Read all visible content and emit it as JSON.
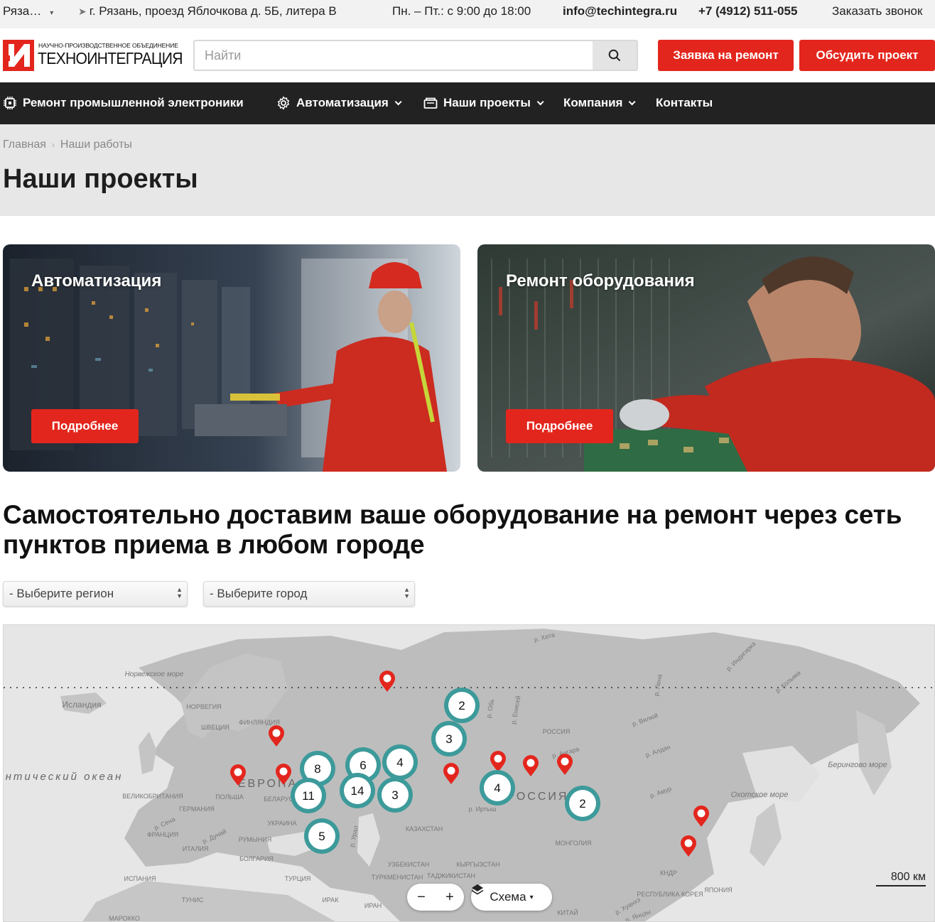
{
  "topbar": {
    "city": "Ряза…",
    "address": "г. Рязань, проезд Яблочкова д. 5Б, литера В",
    "hours": "Пн. – Пт.: с 9:00 до 18:00",
    "email": "info@techintegra.ru",
    "phone": "+7 (4912) 511-055",
    "callback": "Заказать звонок"
  },
  "logo": {
    "small": "НАУЧНО-ПРОИЗВОДСТВЕННОЕ ОБЪЕДИНЕНИЕ",
    "big": "ТЕХНОИНТЕГРАЦИЯ"
  },
  "search": {
    "placeholder": "Найти"
  },
  "header": {
    "repair_btn": "Заявка на ремонт",
    "discuss_btn": "Обсудить проект"
  },
  "nav": {
    "items": [
      {
        "label": "Ремонт промышленной электроники"
      },
      {
        "label": "Автоматизация"
      },
      {
        "label": "Наши проекты"
      },
      {
        "label": "Компания"
      },
      {
        "label": "Контакты"
      }
    ]
  },
  "breadcrumb": {
    "home": "Главная",
    "current": "Наши работы"
  },
  "page_title": "Наши проекты",
  "cards": [
    {
      "title": "Автоматизация",
      "button": "Подробнее"
    },
    {
      "title": "Ремонт оборудования",
      "button": "Подробнее"
    }
  ],
  "delivery_heading": "Самостоятельно доставим ваше оборудование на ремонт через сеть пунктов приема в любом городе",
  "filters": {
    "region": "- Выберите регион",
    "city": "- Выберите город"
  },
  "map": {
    "clusters": [
      "2",
      "3",
      "8",
      "6",
      "4",
      "11",
      "14",
      "3",
      "5",
      "4",
      "2"
    ],
    "labels": {
      "norway_sea": "Норвежское море",
      "iceland": "Исландия",
      "norway": "НОРВЕГИЯ",
      "finland": "ФИНЛЯНДИЯ",
      "sweden": "ШВЕЦИЯ",
      "atlantic": "Атлантический океан",
      "uk": "ВЕЛИКОБРИТАНИЯ",
      "poland": "ПОЛЬША",
      "belarus": "БЕЛАРУСЬ",
      "germany": "ГЕРМАНИЯ",
      "europe": "ЕВРОПА",
      "ukraine": "УКРАИНА",
      "france": "ФРАНЦИЯ",
      "romania": "РУМЫНИЯ",
      "italy": "ИТАЛИЯ",
      "bulgaria": "БОЛГАРИЯ",
      "spain": "ИСПАНИЯ",
      "turkey": "ТУРЦИЯ",
      "tunisia": "ТУНИС",
      "iraq": "ИРАК",
      "iran": "ИРАН",
      "morocco": "МАРОККО",
      "kazakhstan": "КАЗАХСТАН",
      "uzbekistan": "УЗБЕКИСТАН",
      "turkmenistan": "ТУРКМЕНИСТАН",
      "kyrgyzstan": "КЫРГЫЗСТАН",
      "tajikistan": "ТАДЖИКИСТАН",
      "mongolia": "МОНГОЛИЯ",
      "china": "КИТАЙ",
      "russia_small": "РОССИЯ",
      "russia_big": "РОССИЯ",
      "bering_sea": "Берингово море",
      "okhotsk_sea": "Охотское море",
      "korea": "РЕСПУБЛИКА КОРЕЯ",
      "japan": "ЯПОНИЯ",
      "kndr": "КНДР",
      "ural": "р. Урал",
      "irtysh": "р. Иртыш",
      "ob": "р. Обь",
      "yenisei": "р. Енисей",
      "lena": "р. Лена",
      "vilyuy": "р. Вилюй",
      "aldan": "р. Алдан",
      "amur": "р. Амур",
      "angara": "р. Ангара",
      "kheta": "р. Хета",
      "indigirka": "р. Индигирка",
      "kolyma": "р. Колыма",
      "sena": "р. Сена",
      "danube": "р. Дунай",
      "huanghe": "р. Хуанхэ",
      "yangtze": "р. Янцзы"
    },
    "zoom_out": "−",
    "zoom_in": "+",
    "layer": "Схема",
    "scale": "800 км"
  }
}
